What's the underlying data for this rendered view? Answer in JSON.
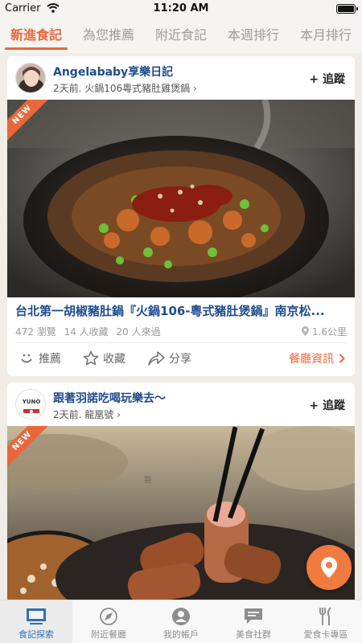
{
  "status_bar": {
    "carrier": "Carrier",
    "time": "11:20 AM"
  },
  "tabs": [
    {
      "label": "新進食記",
      "active": true
    },
    {
      "label": "為您推薦"
    },
    {
      "label": "附近食記"
    },
    {
      "label": "本週排行"
    },
    {
      "label": "本月排行"
    }
  ],
  "posts": [
    {
      "author": "Angelababy享樂日記",
      "meta": "2天前.  火鍋106粵式豬肚雞煲鍋 ›",
      "follow_label": "+ 追蹤",
      "badge": "NEW",
      "title": "台北第一胡椒豬肚鍋『火鍋106-粵式豬肚煲鍋』南京松...",
      "views": "472 瀏覽",
      "saves": "14 人收藏",
      "visits": "20 人來過",
      "distance": "1.6公里",
      "actions": {
        "recommend": "推薦",
        "save": "收藏",
        "share": "分享",
        "info": "餐廳資訊"
      }
    },
    {
      "author": "跟著羽諾吃喝玩樂去～",
      "meta": "2天前.  龍凰號 ›",
      "follow_label": "+ 追蹤",
      "badge": "NEW",
      "avatar_text": "YUNO"
    }
  ],
  "bottom_nav": [
    {
      "label": "食記探索",
      "icon": "monitor-icon",
      "active": true
    },
    {
      "label": "附近餐廳",
      "icon": "compass-icon"
    },
    {
      "label": "我的帳戶",
      "icon": "user-icon"
    },
    {
      "label": "美食社群",
      "icon": "chat-icon"
    },
    {
      "label": "愛食卡專區",
      "icon": "fork-knife-icon"
    }
  ],
  "colors": {
    "accent": "#e8673b",
    "link": "#1f4c8f",
    "nav_active": "#2d6fb8"
  }
}
